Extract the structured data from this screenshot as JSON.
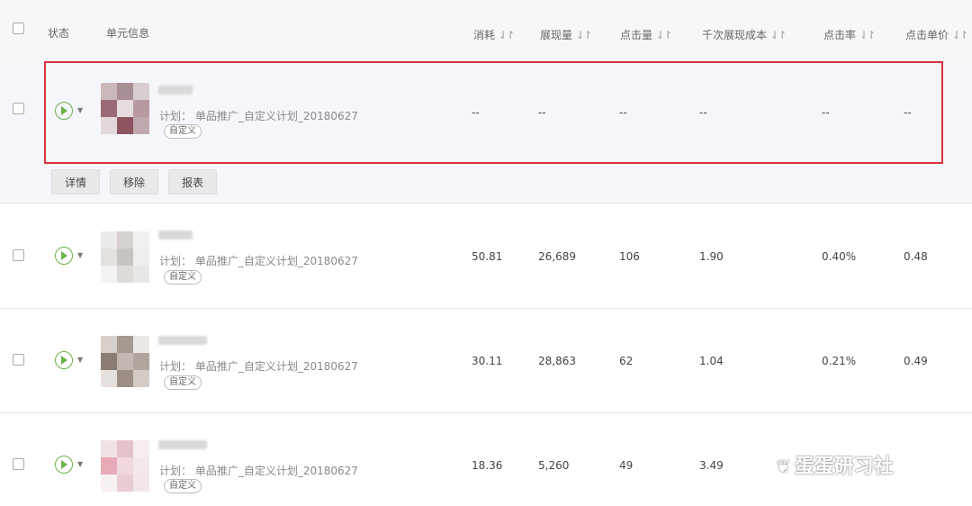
{
  "header": {
    "status": "状态",
    "unit_info": "单元信息",
    "columns": [
      "消耗",
      "展现量",
      "点击量",
      "千次展现成本",
      "点击率",
      "点击单价"
    ],
    "sort_glyph": "⇃↾"
  },
  "rows": [
    {
      "plan": "计划：  单品推广_自定义计划_20180627",
      "tag": "自定义",
      "values": [
        "--",
        "--",
        "--",
        "--",
        "--",
        "--"
      ],
      "thumb_colors": [
        "#c9b7b9",
        "#a88e95",
        "#d8cdd0",
        "#9a6a74",
        "#e4dcdd",
        "#b69aa0",
        "#e2d8da",
        "#8c5560",
        "#c0a9ae"
      ]
    },
    {
      "plan": "计划：  单品推广_自定义计划_20180627",
      "tag": "自定义",
      "values": [
        "50.81",
        "26,689",
        "106",
        "1.90",
        "0.40%",
        "0.48"
      ],
      "thumb_colors": [
        "#ecebeb",
        "#d7d2d0",
        "#f2f1f1",
        "#e4e0de",
        "#c9c3c0",
        "#efeeed",
        "#f3f3f3",
        "#dedad8",
        "#e9e7e6"
      ]
    },
    {
      "plan": "计划：  单品推广_自定义计划_20180627",
      "tag": "自定义",
      "values": [
        "30.11",
        "28,863",
        "62",
        "1.04",
        "0.21%",
        "0.49"
      ],
      "thumb_colors": [
        "#d8d0cb",
        "#a69990",
        "#ece8e5",
        "#8c7d74",
        "#c3b8b1",
        "#b2a59d",
        "#e6e1de",
        "#9e8f86",
        "#d3cbc6"
      ]
    },
    {
      "plan": "计划：  单品推广_自定义计划_20180627",
      "tag": "自定义",
      "values": [
        "18.36",
        "5,260",
        "49",
        "3.49",
        "",
        ""
      ],
      "thumb_colors": [
        "#f1e2e4",
        "#e3c3c9",
        "#f6eeef",
        "#e7aab6",
        "#f0d8dc",
        "#f3e9ea",
        "#f7f1f2",
        "#e9ccd1",
        "#f2e6e8"
      ]
    }
  ],
  "actions": [
    "详情",
    "移除",
    "报表"
  ],
  "watermark": "蛋蛋研习社",
  "colors": {
    "highlight_border": "#d9343a",
    "status_green": "#6bb04a"
  }
}
